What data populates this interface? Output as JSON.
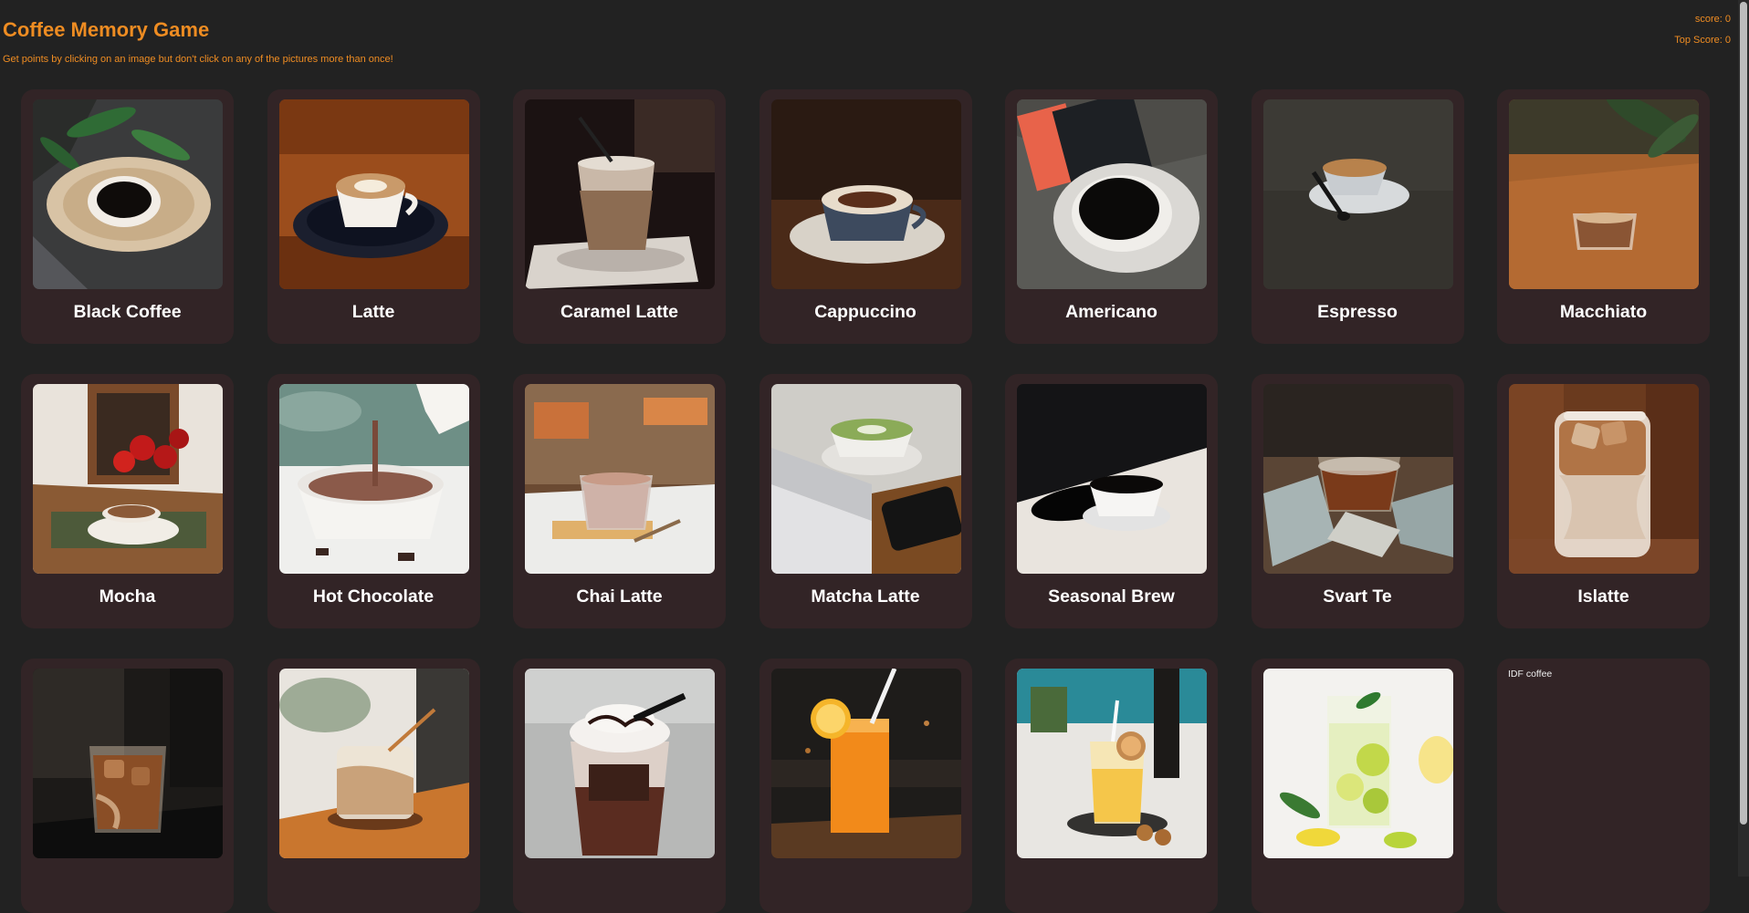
{
  "header": {
    "title": "Coffee Memory Game",
    "instructions": "Get points by clicking on an image but don't click on any of the pictures more than once!",
    "score": "score: 0",
    "top_score": "Top Score: 0"
  },
  "cards": [
    {
      "label": "Black Coffee",
      "icon": "black-coffee-photo"
    },
    {
      "label": "Latte",
      "icon": "latte-photo"
    },
    {
      "label": "Caramel Latte",
      "icon": "caramel-latte-photo"
    },
    {
      "label": "Cappuccino",
      "icon": "cappuccino-photo"
    },
    {
      "label": "Americano",
      "icon": "americano-photo"
    },
    {
      "label": "Espresso",
      "icon": "espresso-photo"
    },
    {
      "label": "Macchiato",
      "icon": "macchiato-photo"
    },
    {
      "label": "Mocha",
      "icon": "mocha-photo"
    },
    {
      "label": "Hot Chocolate",
      "icon": "hot-chocolate-photo"
    },
    {
      "label": "Chai Latte",
      "icon": "chai-latte-photo"
    },
    {
      "label": "Matcha Latte",
      "icon": "matcha-latte-photo"
    },
    {
      "label": "Seasonal Brew",
      "icon": "seasonal-brew-photo"
    },
    {
      "label": "Svart Te",
      "icon": "svart-te-photo"
    },
    {
      "label": "Islatte",
      "icon": "islatte-photo"
    },
    {
      "label": "",
      "icon": "iced-coffee-photo"
    },
    {
      "label": "",
      "icon": "iced-latte-photo"
    },
    {
      "label": "",
      "icon": "frappe-photo"
    },
    {
      "label": "",
      "icon": "orange-juice-photo"
    },
    {
      "label": "",
      "icon": "citrus-drink-photo"
    },
    {
      "label": "",
      "icon": "lemonade-photo"
    },
    {
      "label": "",
      "alt": "IDF coffee",
      "icon": "broken-image-icon"
    }
  ]
}
